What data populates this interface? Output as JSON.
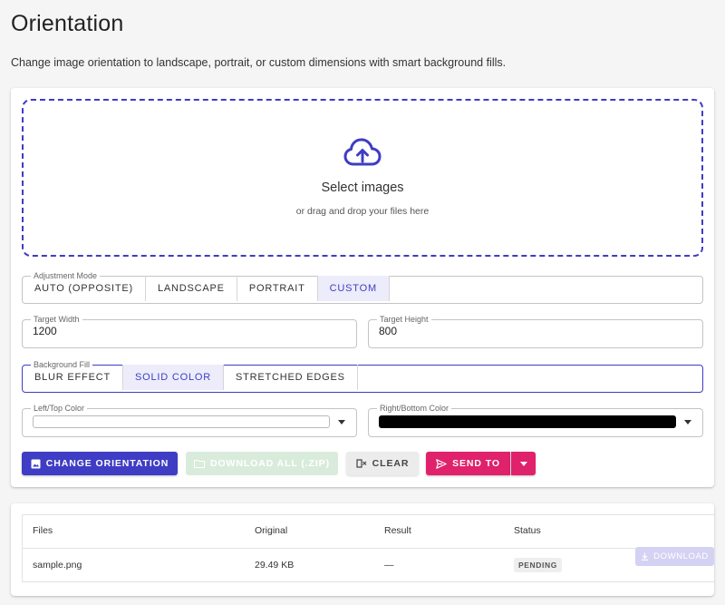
{
  "page": {
    "title": "Orientation",
    "description": "Change image orientation to landscape, portrait, or custom dimensions with smart background fills."
  },
  "dropzone": {
    "title": "Select images",
    "subtitle": "or drag and drop your files here",
    "icon": "cloud-upload-icon"
  },
  "adjustment_mode": {
    "legend": "Adjustment Mode",
    "options": [
      "AUTO (OPPOSITE)",
      "LANDSCAPE",
      "PORTRAIT",
      "CUSTOM"
    ],
    "selected": "CUSTOM"
  },
  "target_width": {
    "label": "Target Width",
    "value": "1200"
  },
  "target_height": {
    "label": "Target Height",
    "value": "800"
  },
  "background_fill": {
    "legend": "Background Fill",
    "options": [
      "BLUR EFFECT",
      "SOLID COLOR",
      "STRETCHED EDGES"
    ],
    "selected": "SOLID COLOR"
  },
  "left_top_color": {
    "label": "Left/Top Color",
    "color": "#ffffff"
  },
  "right_bottom_color": {
    "label": "Right/Bottom Color",
    "color": "#000000"
  },
  "actions": {
    "change_orientation": "CHANGE ORIENTATION",
    "download_all": "DOWNLOAD ALL (.ZIP)",
    "clear": "CLEAR",
    "send_to": "SEND TO"
  },
  "table": {
    "columns": [
      "Files",
      "Original",
      "Result",
      "Status"
    ],
    "rows": [
      {
        "file": "sample.png",
        "original": "29.49 KB",
        "result": "—",
        "status": "PENDING",
        "action": "DOWNLOAD"
      }
    ]
  },
  "colors": {
    "primary": "#3f3dc4",
    "accent": "#e0216b",
    "selected_bg": "#ececfa"
  }
}
